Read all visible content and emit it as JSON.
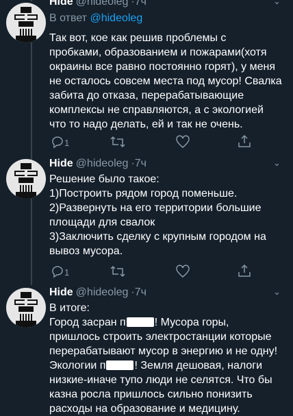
{
  "tweet1": {
    "name": "Hide",
    "handle": "@hideoleg",
    "time": "7ч",
    "reply_prefix": "В ответ",
    "reply_mention": "@hideoleg",
    "lines": [
      "Так вот, кое как решив проблемы с",
      "пробками, образованием и пожарами(хотя",
      "окраины все равно постоянно горят), у меня",
      "не осталось совсем места под мусор! Свалка",
      "забита до отказа, перерабатывающие",
      "комплексы не справляются, а с экологией",
      "что то надо делать, ей и так не очень."
    ],
    "reply_count": "1"
  },
  "tweet2": {
    "name": "Hide",
    "handle": "@hideoleg",
    "time": "7ч",
    "lines": [
      "Решение было такое:",
      "1)Построить рядом город поменьше.",
      "2)Развернуть на его территории большие",
      "площади для свалок",
      "3)Заключить сделку с крупным городом на",
      "вывоз мусора."
    ],
    "reply_count": "1"
  },
  "tweet3": {
    "name": "Hide",
    "handle": "@hideoleg",
    "time": "7ч",
    "line1": "В итоге:",
    "line2_a": "Город засран п",
    "line2_b": "! Мусора горы,",
    "lines_mid": [
      "пришлось строить электростанции которые",
      "перерабатывают мусор в энергию и не одну!"
    ],
    "line5_a": "Экологии п",
    "line5_b": "! Земля дешовая, налоги",
    "lines_end": [
      "низкие-иначе тупо люди не селятся. Что бы",
      "казна росла пришлось сильно понизить",
      "расходы на образование и медицину."
    ]
  },
  "colors": {
    "background": "#15202b",
    "secondary_text": "#8899a6",
    "link": "#1da1f2",
    "thread_line": "#38444d"
  },
  "icons": [
    "reply-icon",
    "retweet-icon",
    "like-icon",
    "share-icon",
    "chevron-down-icon"
  ]
}
